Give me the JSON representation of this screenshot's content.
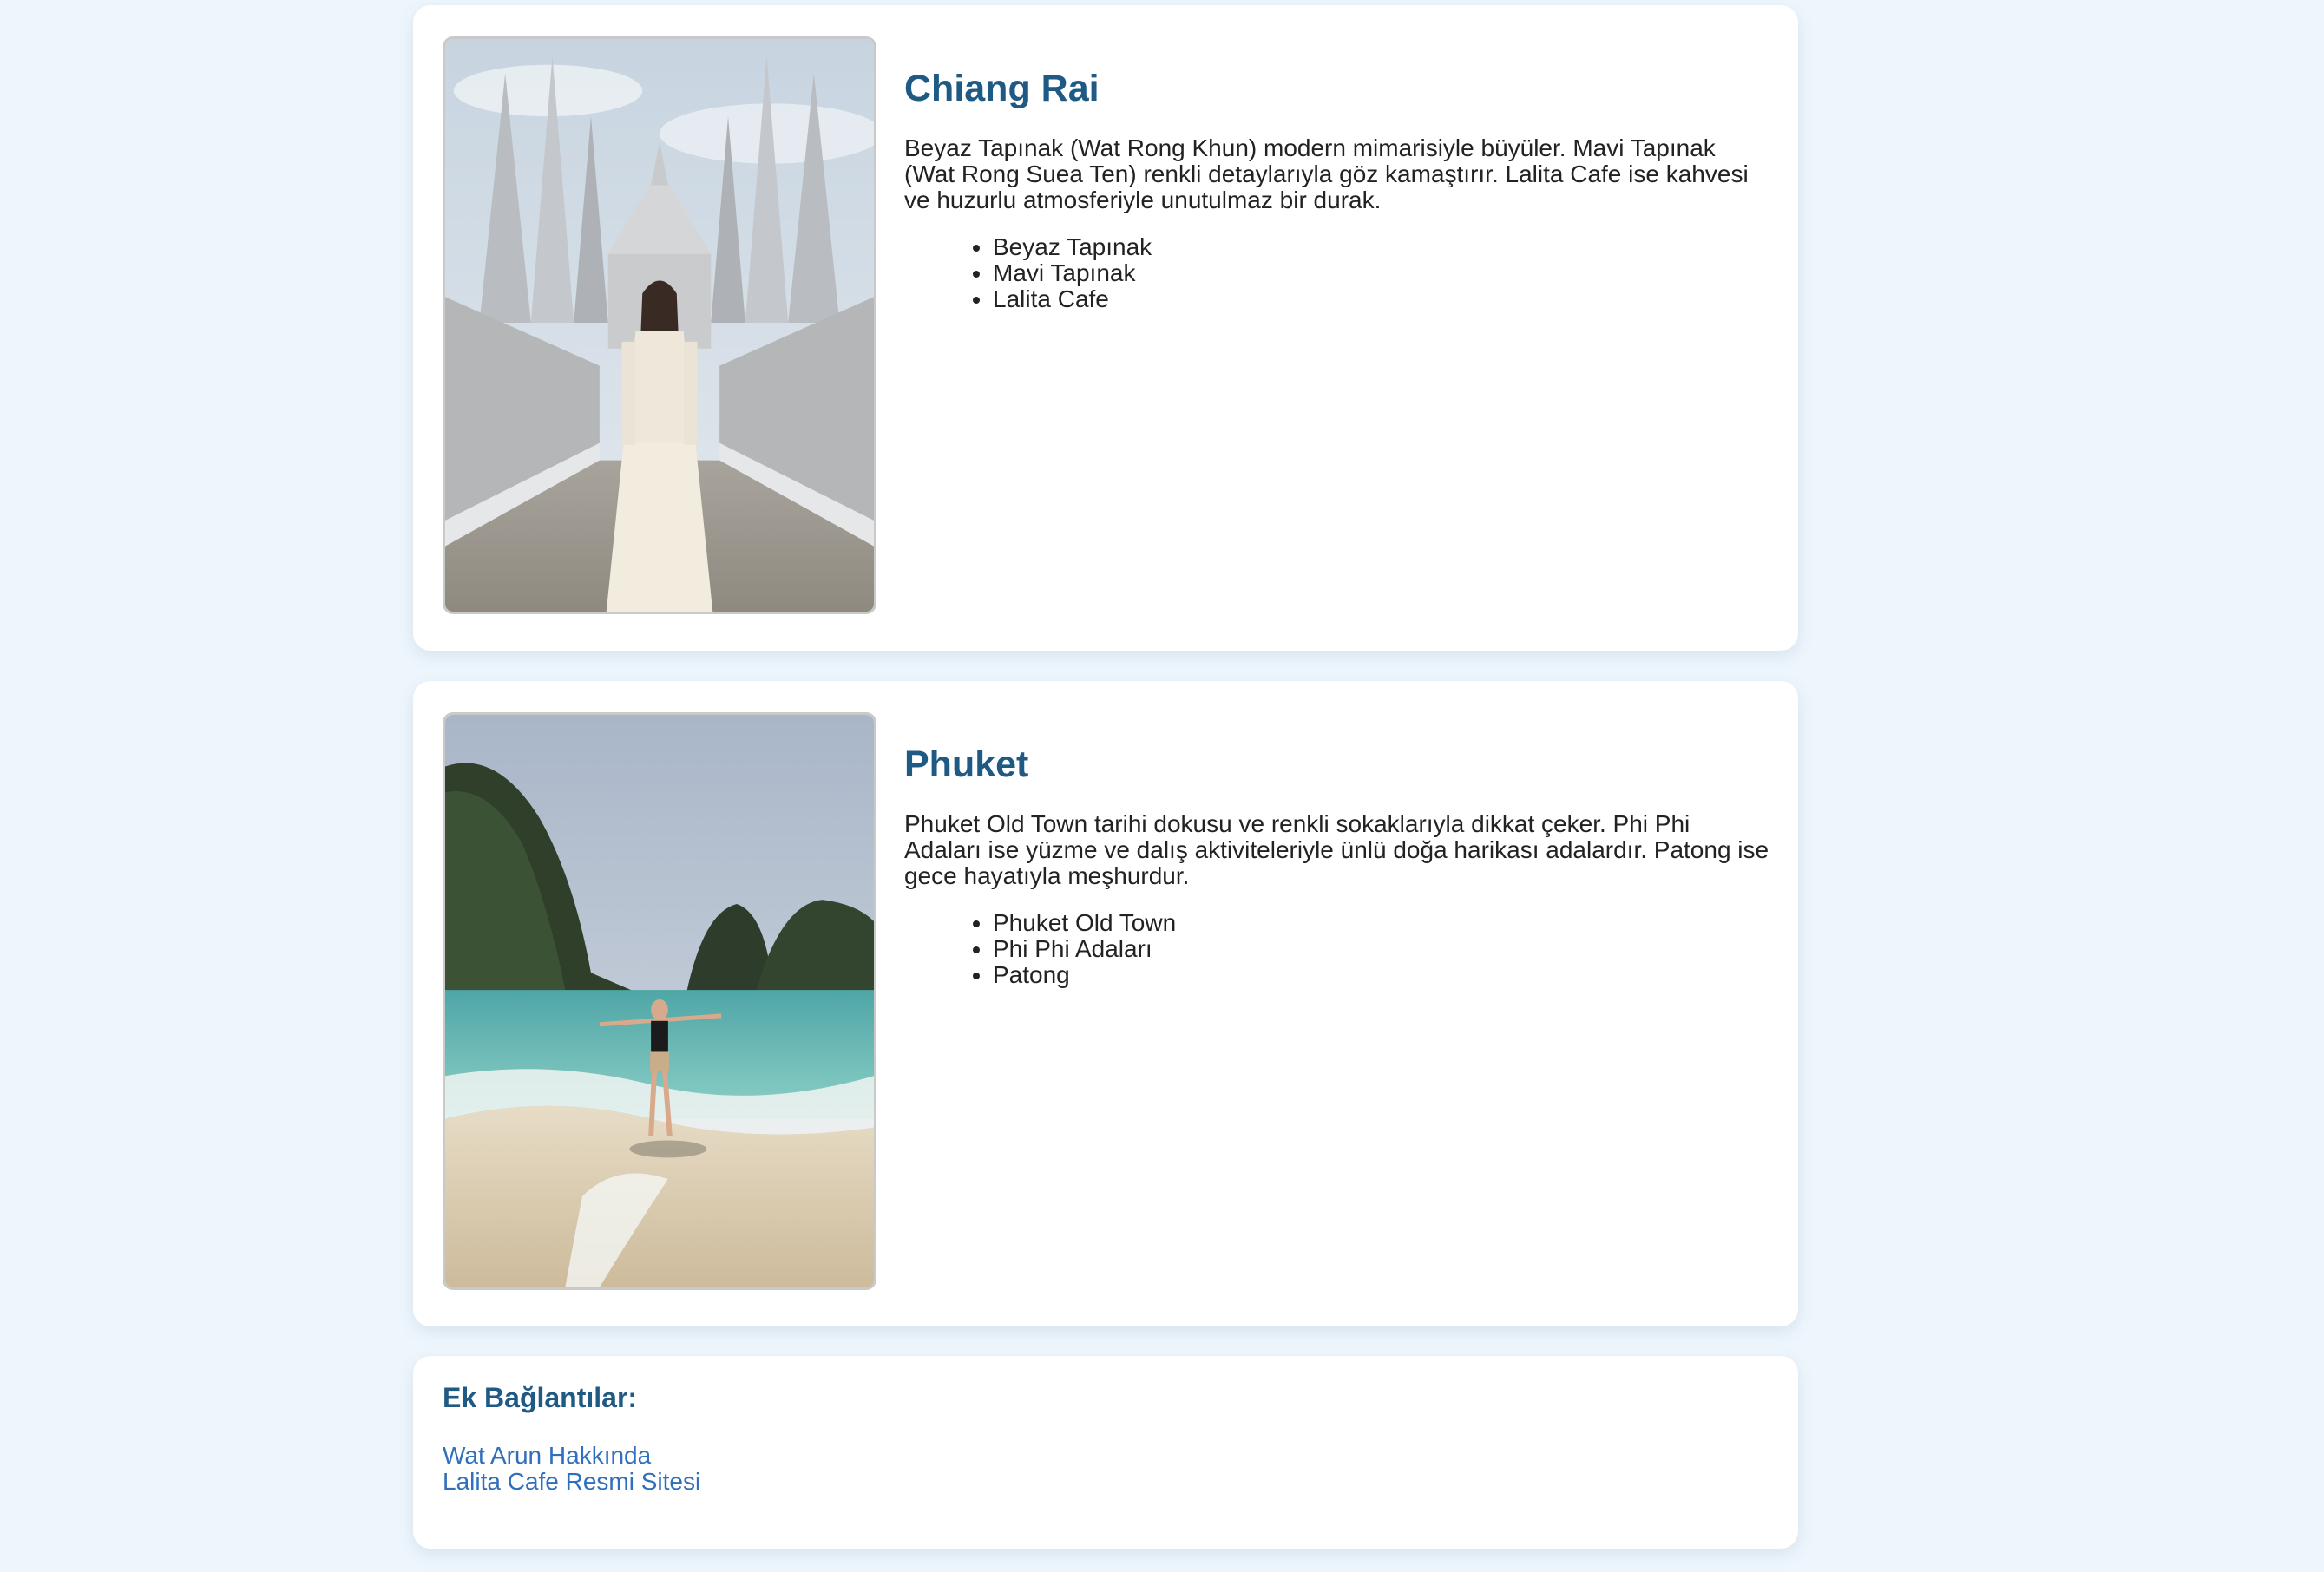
{
  "colors": {
    "background": "#eef6fd",
    "card": "#ffffff",
    "heading": "#1f5a85",
    "link": "#2f6fbb",
    "text": "#222222"
  },
  "destinations": [
    {
      "title": "Chiang Rai",
      "description": "Beyaz Tapınak (Wat Rong Khun) modern mimarisiyle büyüler. Mavi Tapınak (Wat Rong Suea Ten) renkli detaylarıyla göz kamaştırır. Lalita Cafe ise kahvesi ve huzurlu atmosferiyle unutulmaz bir durak.",
      "places": [
        "Beyaz Tapınak",
        "Mavi Tapınak",
        "Lalita Cafe"
      ],
      "photo_subject": "white-temple-photo"
    },
    {
      "title": "Phuket",
      "description": "Phuket Old Town tarihi dokusu ve renkli sokaklarıyla dikkat çeker. Phi Phi Adaları ise yüzme ve dalış aktiviteleriyle ünlü doğa harikası adalardır. Patong ise gece hayatıyla meşhurdur.",
      "places": [
        "Phuket Old Town",
        "Phi Phi Adaları",
        "Patong"
      ],
      "photo_subject": "beach-photo"
    }
  ],
  "extra_links": {
    "title": "Ek Bağlantılar:",
    "items": [
      "Wat Arun Hakkında",
      "Lalita Cafe Resmi Sitesi"
    ]
  }
}
